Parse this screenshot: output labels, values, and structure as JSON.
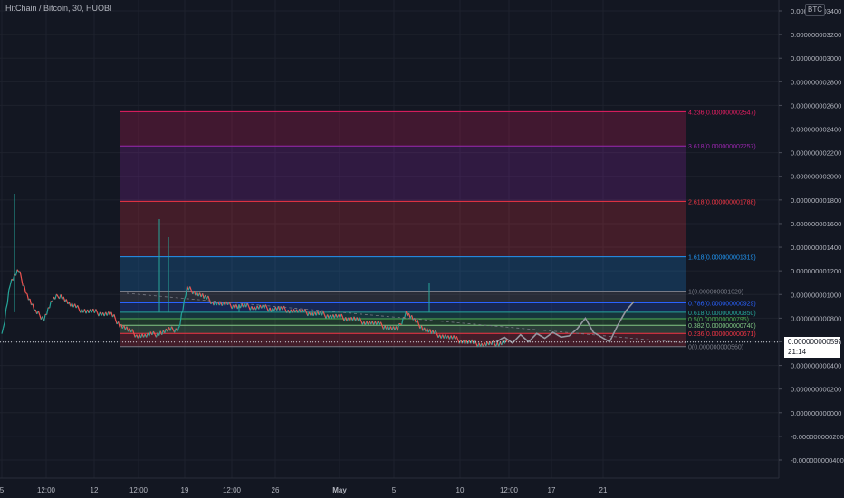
{
  "header": {
    "title": "HitChain / Bitcoin, 30, HUOBI"
  },
  "scale_badge": "BTC",
  "last_price": {
    "value": "0.0000000005976",
    "countdown": "21:14"
  },
  "colors": {
    "background": "#131722",
    "grid": "#1e222d",
    "axis_text": "#b2b5be",
    "candle_up": "#26a69a",
    "candle_down": "#ef5350",
    "projection": "#9598a1"
  },
  "chart_data": {
    "type": "line",
    "title": "HitChain / Bitcoin, 30, HUOBI",
    "xlabel": "",
    "ylabel": "",
    "ylim": [
      -4e-10,
      3.4e-09
    ],
    "y_ticks": [
      "0.000000003400",
      "0.000000003200",
      "0.000000003000",
      "0.000000002800",
      "0.000000002600",
      "0.000000002400",
      "0.000000002200",
      "0.000000002000",
      "0.000000001800",
      "0.000000001600",
      "0.000000001400",
      "0.000000001200",
      "0.000000001000",
      "0.000000000800",
      "0.000000000600",
      "0.000000000400",
      "0.000000000200",
      "0.000000000000",
      "-0.000000000200",
      "-0.000000000400"
    ],
    "x_ticks": [
      "5",
      "12:00",
      "12",
      "12:00",
      "19",
      "12:00",
      "26",
      "May",
      "5",
      "10",
      "12:00",
      "17",
      "21"
    ],
    "fibonacci_levels": [
      {
        "ratio": "4.236",
        "price": "0.000000002547",
        "label": "4.236(0.000000002547)",
        "color": "#e91e63"
      },
      {
        "ratio": "3.618",
        "price": "0.000000002257",
        "label": "3.618(0.000000002257)",
        "color": "#9c27b0"
      },
      {
        "ratio": "2.618",
        "price": "0.000000001788",
        "label": "2.618(0.000000001788)",
        "color": "#f23645"
      },
      {
        "ratio": "1.618",
        "price": "0.000000001319",
        "label": "1.618(0.000000001319)",
        "color": "#2196f3"
      },
      {
        "ratio": "1",
        "price": "0.000000001029",
        "label": "1(0.000000001029)",
        "color": "#787b86"
      },
      {
        "ratio": "0.786",
        "price": "0.000000000929",
        "label": "0.786(0.000000000929)",
        "color": "#2962ff"
      },
      {
        "ratio": "0.618",
        "price": "0.000000000850",
        "label": "0.618(0.000000000850)",
        "color": "#26a69a"
      },
      {
        "ratio": "0.5",
        "price": "0.000000000795",
        "label": "0.5(0.000000000795)",
        "color": "#4caf50"
      },
      {
        "ratio": "0.382",
        "price": "0.000000000740",
        "label": "0.382(0.000000000740)",
        "color": "#81c784"
      },
      {
        "ratio": "0.236",
        "price": "0.000000000671",
        "label": "0.236(0.000000000671)",
        "color": "#f23645"
      },
      {
        "ratio": "0",
        "price": "0.000000000560",
        "label": "0(0.000000000560)",
        "color": "#787b86"
      }
    ],
    "series": [
      {
        "values": [
          6.4e-10,
          1.1e-09,
          1.2e-09,
          1e-09,
          8.5e-10,
          8e-10,
          9.5e-10,
          1e-09,
          9.2e-10,
          8.8e-10,
          8.6e-10,
          8.5e-10,
          8.4e-10,
          8.3e-10,
          7.5e-10,
          7e-10,
          6.6e-10,
          6.5e-10,
          6.6e-10,
          6.8e-10,
          7e-10,
          7.1e-10,
          1.05e-09,
          1.02e-09,
          9.8e-10,
          9.4e-10,
          9.2e-10,
          9.1e-10,
          9e-10,
          9e-10,
          8.9e-10,
          8.9e-10,
          8.8e-10,
          8.8e-10,
          8.7e-10,
          8.6e-10,
          8.5e-10,
          8.4e-10,
          8.3e-10,
          8.2e-10,
          8.1e-10,
          8e-10,
          7.9e-10,
          7.7e-10,
          7.6e-10,
          7.4e-10,
          7.2e-10,
          7e-10,
          8.5e-10,
          7.8e-10,
          7.2e-10,
          6.8e-10,
          6.6e-10,
          6.4e-10,
          6.2e-10,
          6e-10,
          5.9e-10,
          5.8e-10,
          5.8e-10,
          5.9e-10,
          6e-10
        ]
      },
      {
        "values": [
          6e-10,
          6.4e-10,
          5.9e-10,
          6.6e-10,
          6e-10,
          6.7e-10,
          6.3e-10,
          6.8e-10,
          6.4e-10,
          6.5e-10,
          7.1e-10,
          8e-10,
          6.8e-10,
          6.4e-10,
          6e-10,
          7.4e-10,
          8.6e-10,
          9.4e-10
        ]
      }
    ]
  }
}
